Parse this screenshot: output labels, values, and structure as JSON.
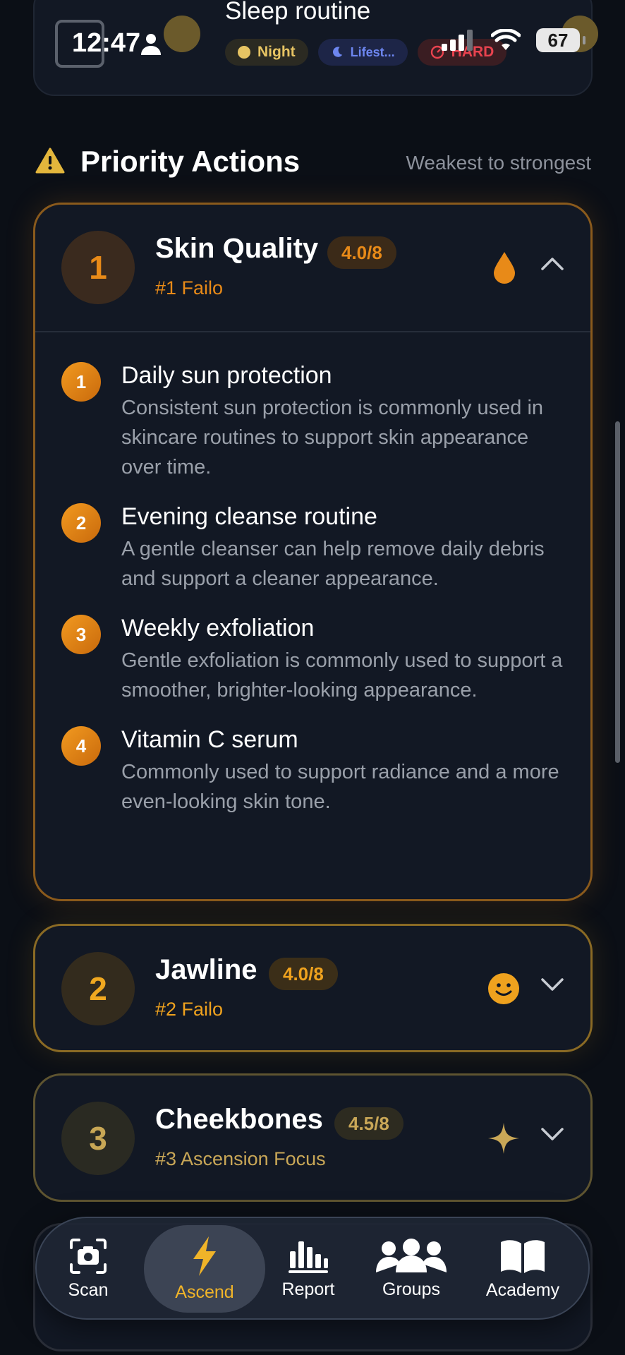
{
  "status_bar": {
    "time": "12:47",
    "battery": "67"
  },
  "routine": {
    "title": "Sleep routine",
    "chips": {
      "night": "Night",
      "lifestyle": "Lifest...",
      "difficulty": "HARD"
    }
  },
  "section": {
    "title": "Priority Actions",
    "subtitle": "Weakest to strongest"
  },
  "priorities": [
    {
      "rank": "1",
      "name": "Skin Quality",
      "score": "4.0/8",
      "tag": "#1 Failo",
      "expanded": true,
      "steps": [
        {
          "num": "1",
          "title": "Daily sun protection",
          "desc": "Consistent sun protection is commonly used in skincare routines to support skin appearance over time."
        },
        {
          "num": "2",
          "title": "Evening cleanse routine",
          "desc": "A gentle cleanser can help remove daily debris and support a cleaner appearance."
        },
        {
          "num": "3",
          "title": "Weekly exfoliation",
          "desc": "Gentle exfoliation is commonly used to support a smoother, brighter-looking appearance."
        },
        {
          "num": "4",
          "title": "Vitamin C serum",
          "desc": "Commonly used to support radiance and a more even-looking skin tone."
        }
      ]
    },
    {
      "rank": "2",
      "name": "Jawline",
      "score": "4.0/8",
      "tag": "#2 Failo",
      "expanded": false
    },
    {
      "rank": "3",
      "name": "Cheekbones",
      "score": "4.5/8",
      "tag": "#3 Ascension Focus",
      "expanded": false
    }
  ],
  "tabs": [
    {
      "label": "Scan",
      "icon": "camera-icon"
    },
    {
      "label": "Ascend",
      "icon": "lightning-icon",
      "active": true
    },
    {
      "label": "Report",
      "icon": "bar-chart-icon"
    },
    {
      "label": "Groups",
      "icon": "people-icon"
    },
    {
      "label": "Academy",
      "icon": "book-icon"
    }
  ],
  "colors": {
    "accent_orange": "#e88a18",
    "accent_gold": "#f0b429",
    "background": "#0b0f16",
    "card": "#121824"
  }
}
